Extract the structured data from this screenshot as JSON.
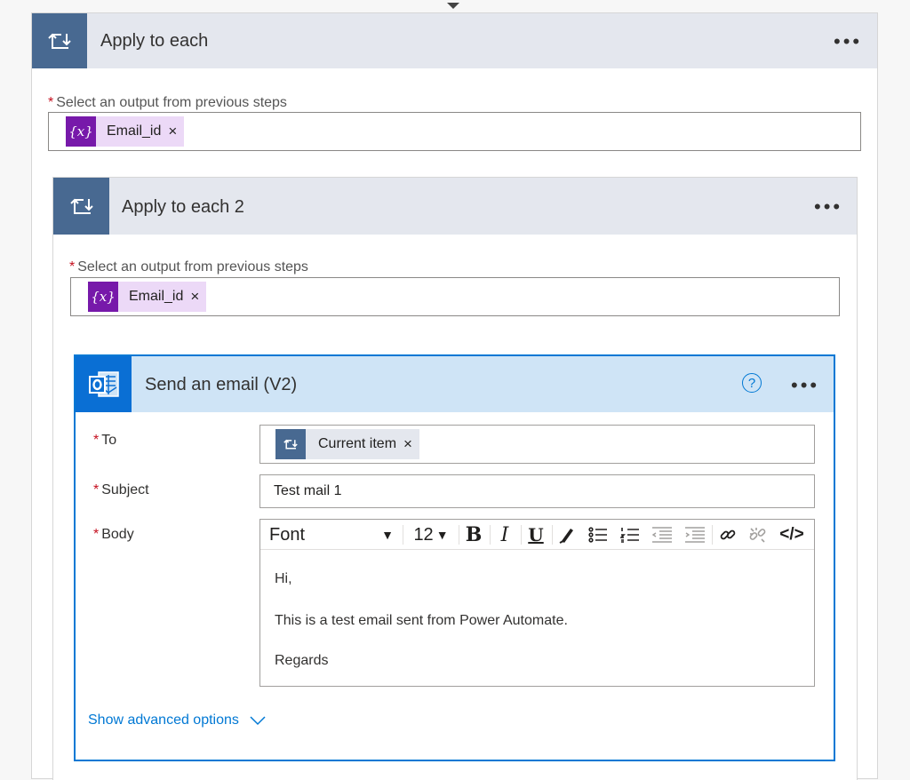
{
  "outer_loop": {
    "title": "Apply to each",
    "more_label": "•••",
    "field_label": "Select an output from previous steps",
    "required_mark": "*",
    "token": {
      "icon": "{x}",
      "label": "Email_id",
      "remove": "×"
    }
  },
  "inner_loop": {
    "title": "Apply to each 2",
    "more_label": "•••",
    "field_label": "Select an output from previous steps",
    "required_mark": "*",
    "token": {
      "icon": "{x}",
      "label": "Email_id",
      "remove": "×"
    }
  },
  "email_action": {
    "title": "Send an email (V2)",
    "help_label": "?",
    "more_label": "•••",
    "fields": {
      "to": {
        "label": "To",
        "required_mark": "*",
        "token": {
          "label": "Current item",
          "remove": "×"
        }
      },
      "subject": {
        "label": "Subject",
        "required_mark": "*",
        "value": "Test mail 1"
      },
      "body": {
        "label": "Body",
        "required_mark": "*",
        "toolbar": {
          "font": "Font",
          "font_size": "12",
          "bold": "B",
          "italic": "I",
          "underline": "U",
          "code": "</>"
        },
        "lines": [
          "Hi,",
          "This is a test email sent from Power Automate.",
          "Regards"
        ]
      }
    },
    "advanced_label": "Show advanced options"
  },
  "colors": {
    "loop_icon_bg": "#486991",
    "loop_header_bg": "#e4e7ee",
    "token_icon_bg": "#7719aa",
    "token_bg": "#ecd9f7",
    "email_accent": "#0078d4",
    "email_header_bg": "#cfe4f6",
    "required": "#c50f1f"
  },
  "icons": {
    "loop": "loop-icon",
    "outlook": "outlook-icon",
    "help": "help-icon",
    "chevron": "chevron-down-icon"
  }
}
